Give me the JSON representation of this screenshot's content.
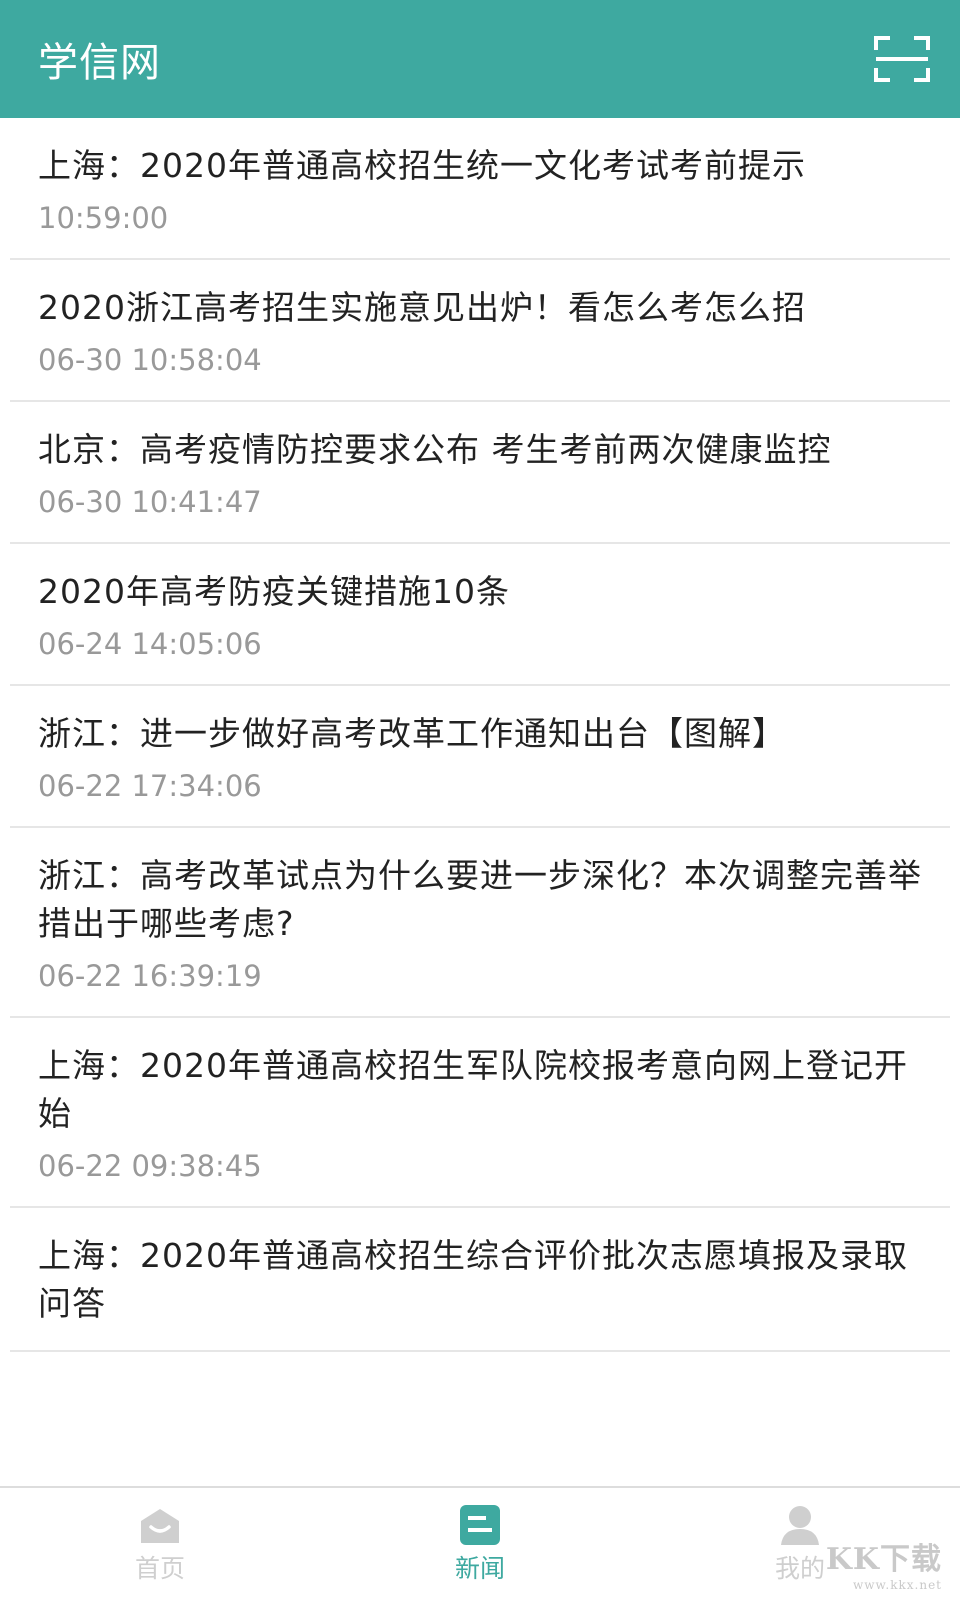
{
  "header": {
    "title": "学信网",
    "scan_icon": "scan-icon"
  },
  "news": [
    {
      "title": "上海：2020年普通高校招生统一文化考试考前提示",
      "time": "10:59:00"
    },
    {
      "title": "2020浙江高考招生实施意见出炉！看怎么考怎么招",
      "time": "06-30 10:58:04"
    },
    {
      "title": "北京：高考疫情防控要求公布  考生考前两次健康监控",
      "time": "06-30 10:41:47"
    },
    {
      "title": "2020年高考防疫关键措施10条",
      "time": "06-24 14:05:06"
    },
    {
      "title": "浙江：进一步做好高考改革工作通知出台【图解】",
      "time": "06-22 17:34:06"
    },
    {
      "title": "浙江：高考改革试点为什么要进一步深化？本次调整完善举措出于哪些考虑?",
      "time": "06-22 16:39:19"
    },
    {
      "title": "上海：2020年普通高校招生军队院校报考意向网上登记开始",
      "time": "06-22 09:38:45"
    },
    {
      "title": "上海：2020年普通高校招生综合评价批次志愿填报及录取问答",
      "time": ""
    }
  ],
  "tabs": [
    {
      "label": "首页",
      "icon": "home-icon",
      "active": false
    },
    {
      "label": "新闻",
      "icon": "news-icon",
      "active": true
    },
    {
      "label": "我的",
      "icon": "profile-icon",
      "active": false
    }
  ],
  "watermark": {
    "main": "KK下载",
    "sub": "www.kkx.net"
  },
  "colors": {
    "accent": "#3ea9a0",
    "inactive": "#cfcfcf",
    "time": "#999999"
  }
}
